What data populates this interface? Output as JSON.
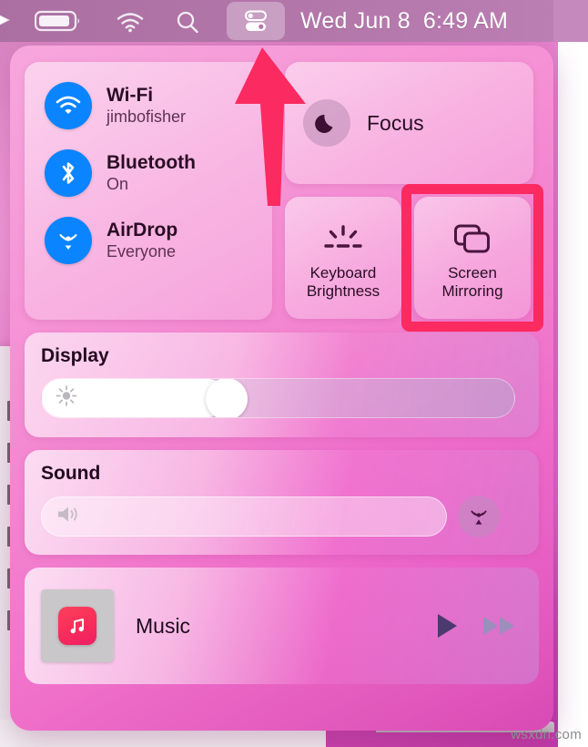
{
  "menubar": {
    "icons": [
      {
        "name": "cursor-arrow-icon",
        "label": "Cursor"
      },
      {
        "name": "battery-icon",
        "label": "Battery"
      },
      {
        "name": "wifi-menu-icon",
        "label": "Wi-Fi"
      },
      {
        "name": "search-icon",
        "label": "Spotlight Search"
      },
      {
        "name": "control-center-icon",
        "label": "Control Center"
      }
    ],
    "clock": {
      "date": "Wed Jun 8",
      "time": "6:49 AM"
    }
  },
  "control_center": {
    "connectivity": [
      {
        "icon": "wifi-icon",
        "title": "Wi-Fi",
        "subtitle": "jimbofisher"
      },
      {
        "icon": "bluetooth-icon",
        "title": "Bluetooth",
        "subtitle": "On"
      },
      {
        "icon": "airdrop-icon",
        "title": "AirDrop",
        "subtitle": "Everyone"
      }
    ],
    "focus": {
      "icon": "moon-icon",
      "label": "Focus"
    },
    "squares": [
      {
        "icon": "keyboard-brightness-icon",
        "label": "Keyboard\nBrightness",
        "line1": "Keyboard",
        "line2": "Brightness",
        "highlighted": false
      },
      {
        "icon": "screen-mirroring-icon",
        "label": "Screen\nMirroring",
        "line1": "Screen",
        "line2": "Mirroring",
        "highlighted": true
      }
    ],
    "display": {
      "title": "Display",
      "icon": "brightness-sun-icon",
      "value_percent": 39
    },
    "sound": {
      "title": "Sound",
      "icon": "speaker-icon",
      "value_percent": 0,
      "airplay_button": "airplay-audio-icon"
    },
    "music": {
      "app_icon": "music-app-icon",
      "title": "Music",
      "play_button": "play-icon",
      "forward_button": "fast-forward-icon"
    }
  },
  "annotations": {
    "arrow": {
      "name": "red-arrow-annotation",
      "points_to": "control-center-icon"
    },
    "box": {
      "name": "red-box-annotation",
      "around": "screen-mirroring-tile"
    },
    "accent_color": "#fb2a60"
  },
  "watermark": {
    "text": "wsxdn.com"
  }
}
